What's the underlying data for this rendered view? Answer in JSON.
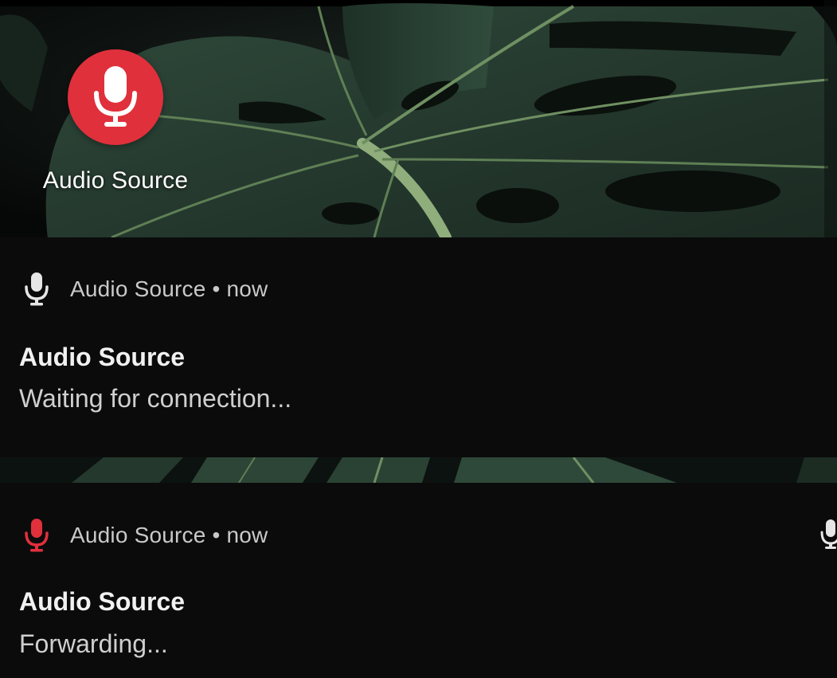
{
  "launcher": {
    "app_label": "Audio Source",
    "icon": "microphone-icon",
    "icon_background": "#e0303c"
  },
  "notifications": [
    {
      "app_name": "Audio Source",
      "separator": "•",
      "time": "now",
      "title": "Audio Source",
      "text": "Waiting for connection...",
      "icon": "microphone-icon",
      "icon_color": "#e6e6e6"
    },
    {
      "app_name": "Audio Source",
      "separator": "•",
      "time": "now",
      "title": "Audio Source",
      "text": "Forwarding...",
      "icon": "microphone-icon",
      "icon_color": "#e0303c",
      "status_icon": "microphone-icon"
    }
  ],
  "colors": {
    "notification_background": "#0b0b0b",
    "title_text": "#f1f1f1",
    "body_text": "#cfcfcf",
    "accent": "#e0303c"
  }
}
